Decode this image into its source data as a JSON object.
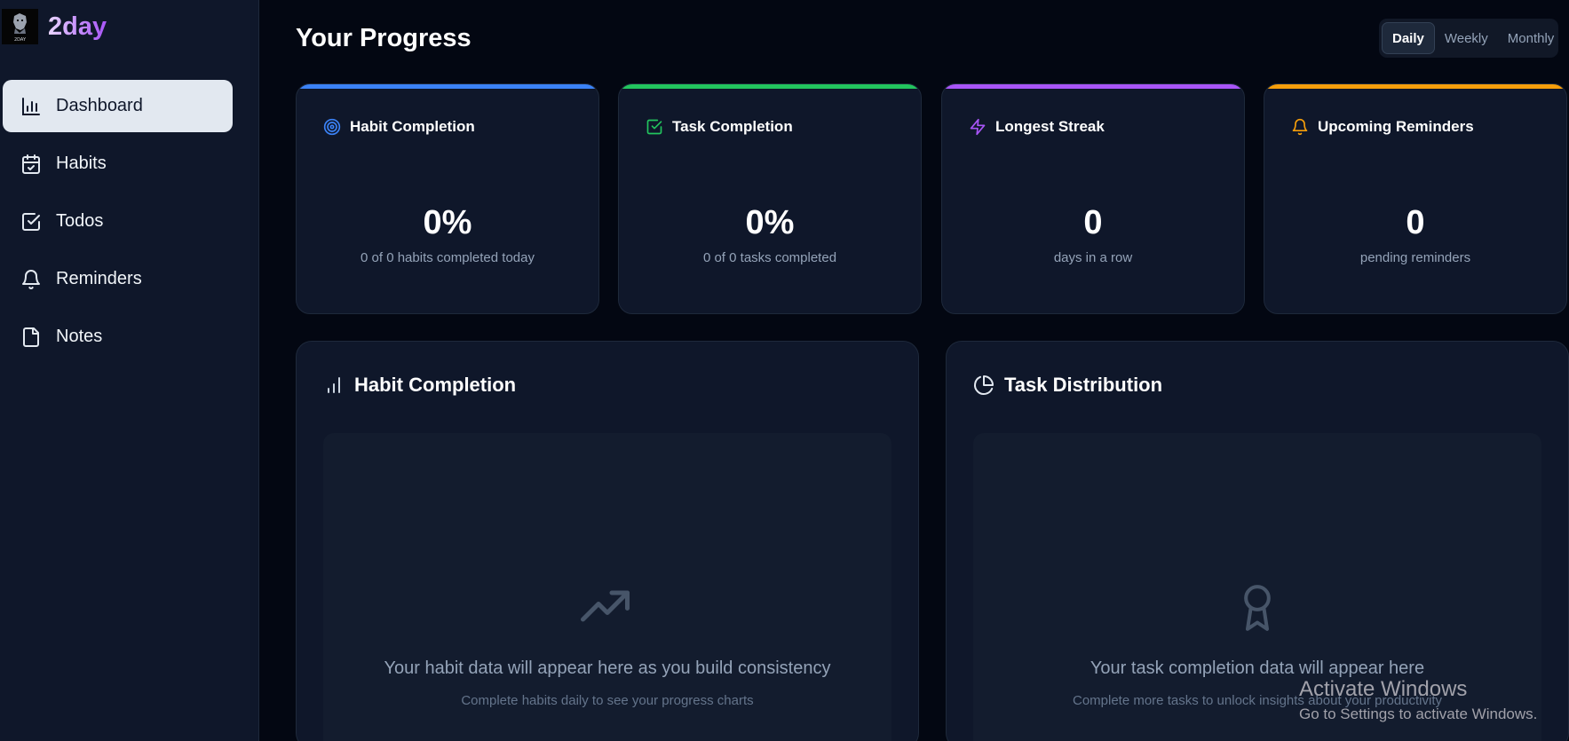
{
  "app": {
    "name": "2day",
    "logo_text": "2DAY"
  },
  "sidebar": {
    "items": [
      {
        "label": "Dashboard",
        "icon": "bar-chart-icon",
        "active": true
      },
      {
        "label": "Habits",
        "icon": "calendar-check-icon"
      },
      {
        "label": "Todos",
        "icon": "checkbox-icon"
      },
      {
        "label": "Reminders",
        "icon": "bell-icon"
      },
      {
        "label": "Notes",
        "icon": "file-icon"
      }
    ]
  },
  "header": {
    "title": "Your Progress",
    "ranges": [
      "Daily",
      "Weekly",
      "Monthly"
    ],
    "selected_range": "Daily"
  },
  "stats": [
    {
      "title": "Habit Completion",
      "value": "0%",
      "sub": "0 of 0 habits completed today",
      "icon": "target-icon",
      "color": "#3b82f6"
    },
    {
      "title": "Task Completion",
      "value": "0%",
      "sub": "0 of 0 tasks completed",
      "icon": "check-square-icon",
      "color": "#22c55e"
    },
    {
      "title": "Longest Streak",
      "value": "0",
      "sub": "days in a row",
      "icon": "zap-icon",
      "color": "#a855f7"
    },
    {
      "title": "Upcoming Reminders",
      "value": "0",
      "sub": "pending reminders",
      "icon": "bell-icon",
      "color": "#f59e0b"
    }
  ],
  "panels": {
    "habit": {
      "title": "Habit Completion",
      "icon": "bar-chart-icon",
      "empty_title": "Your habit data will appear here as you build consistency",
      "empty_sub": "Complete habits daily to see your progress charts",
      "empty_icon": "trending-up-icon"
    },
    "task": {
      "title": "Task Distribution",
      "icon": "pie-chart-icon",
      "empty_title": "Your task completion data will appear here",
      "empty_sub": "Complete more tasks to unlock insights about your productivity",
      "empty_icon": "award-icon"
    }
  },
  "watermark": {
    "title": "Activate Windows",
    "subtitle": "Go to Settings to activate Windows."
  }
}
